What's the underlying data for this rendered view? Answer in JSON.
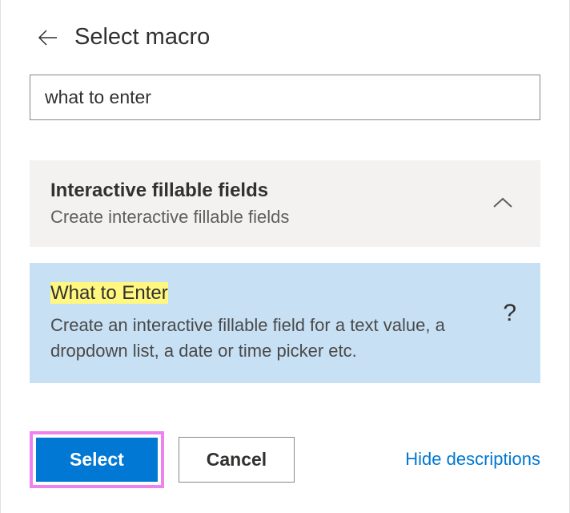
{
  "header": {
    "title": "Select macro"
  },
  "search": {
    "value": "what to enter"
  },
  "category": {
    "title": "Interactive fillable fields",
    "description": "Create interactive fillable fields"
  },
  "macro": {
    "title": "What to Enter",
    "description": "Create an interactive fillable field for a text value, a dropdown list, a date or time picker etc.",
    "help_symbol": "?"
  },
  "footer": {
    "select_label": "Select",
    "cancel_label": "Cancel",
    "hide_descriptions_label": "Hide descriptions"
  }
}
